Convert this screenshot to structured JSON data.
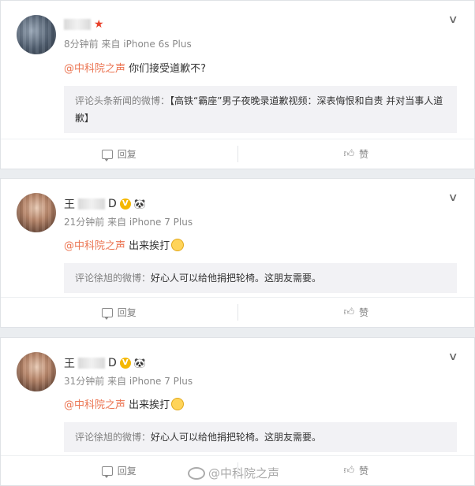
{
  "comments": [
    {
      "meta": "8分钟前 来自 iPhone 6s Plus",
      "mention": "@中科院之声",
      "text": " 你们接受道歉不?",
      "quote_label": "评论头条新闻的微博：",
      "quote_text": "【高铁“霸座”男子夜晚录道歉视频：深表悔恨和自责 并对当事人道歉】",
      "reply": "回复",
      "like": "赞"
    },
    {
      "name_prefix": "王",
      "name_suffix": "D",
      "meta": "21分钟前 来自 iPhone 7 Plus",
      "mention": "@中科院之声",
      "text": " 出来挨打",
      "quote_label": "评论徐旭的微博：",
      "quote_text": "好心人可以给他捐把轮椅。这朋友需要。",
      "reply": "回复",
      "like": "赞"
    },
    {
      "name_prefix": "王",
      "name_suffix": "D",
      "meta": "31分钟前 来自 iPhone 7 Plus",
      "mention": "@中科院之声",
      "text": " 出来挨打",
      "quote_label": "评论徐旭的微博：",
      "quote_text": "好心人可以给他捐把轮椅。这朋友需要。",
      "reply": "回复",
      "like": "赞"
    }
  ],
  "watermark": "@中科院之声"
}
